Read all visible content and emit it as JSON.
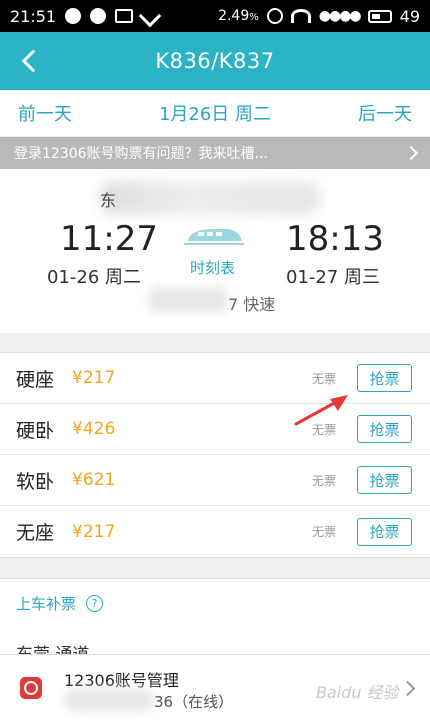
{
  "status_bar": {
    "time": "21:51",
    "battery_percent_text": "2.49",
    "percent_unit": "%",
    "battery_level": "49"
  },
  "header": {
    "title": "K836/K837"
  },
  "date_nav": {
    "prev_label": "前一天",
    "current_date": "1月26日 周二",
    "next_label": "后一天"
  },
  "notice": {
    "text": "登录12306账号购票有问题？我来吐槽..."
  },
  "train": {
    "station_hint": "东",
    "depart_time": "11:27",
    "depart_date": "01-26 周二",
    "arrive_time": "18:13",
    "arrive_date": "01-27 周三",
    "timetable_label": "时刻表",
    "speed_text": "7 快速"
  },
  "seats": [
    {
      "name": "硬座",
      "price": "¥217",
      "availability": "无票",
      "action": "抢票"
    },
    {
      "name": "硬卧",
      "price": "¥426",
      "availability": "无票",
      "action": "抢票"
    },
    {
      "name": "软卧",
      "price": "¥621",
      "availability": "无票",
      "action": "抢票"
    },
    {
      "name": "无座",
      "price": "¥217",
      "availability": "无票",
      "action": "抢票"
    }
  ],
  "supplement": {
    "label": "上车补票",
    "help_glyph": "?"
  },
  "station_partial": "东莞 通道",
  "account": {
    "title": "12306账号管理",
    "status": "36（在线）",
    "watermark": "Baidu 经验"
  },
  "colors": {
    "accent": "#29b3c4",
    "price": "#f3a51c",
    "arrow": "#e53935"
  }
}
